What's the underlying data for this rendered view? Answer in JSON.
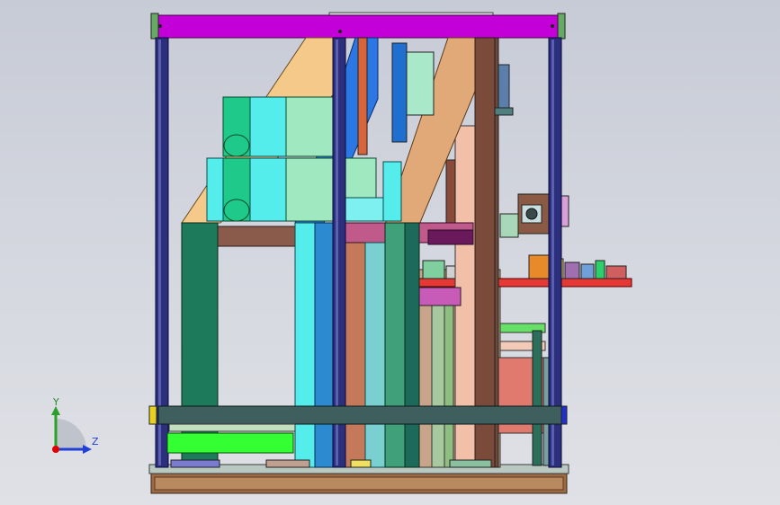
{
  "viewport": {
    "background_top": "#c7cbd6",
    "background_bottom": "#dfe1e6"
  },
  "colors": {
    "top_beam": "#c400d8",
    "frame_posts": "#2b2f7c",
    "diagonal_tan": "#f5c98a",
    "diagonal_blue": "#2b78e4",
    "diagonal_brown_light": "#e2a978",
    "cylinder_green": "#1ec98a",
    "cylinder_cyan": "#55ecec",
    "cylinder_mint": "#9fe8c0",
    "dark_green_column": "#1d7a5a",
    "plate_brown": "#8a5a4a",
    "red_table": "#e53935",
    "bottom_beam": "#3f5f5f",
    "lime_block": "#33ff33",
    "salmon_block": "#e07a6e",
    "base_plate": "#9c6a45"
  },
  "triad": {
    "y_label": "Y",
    "z_label": "Z",
    "y_color": "#2aa02a",
    "z_color": "#1f3fd6",
    "origin_color": "#e00000"
  }
}
